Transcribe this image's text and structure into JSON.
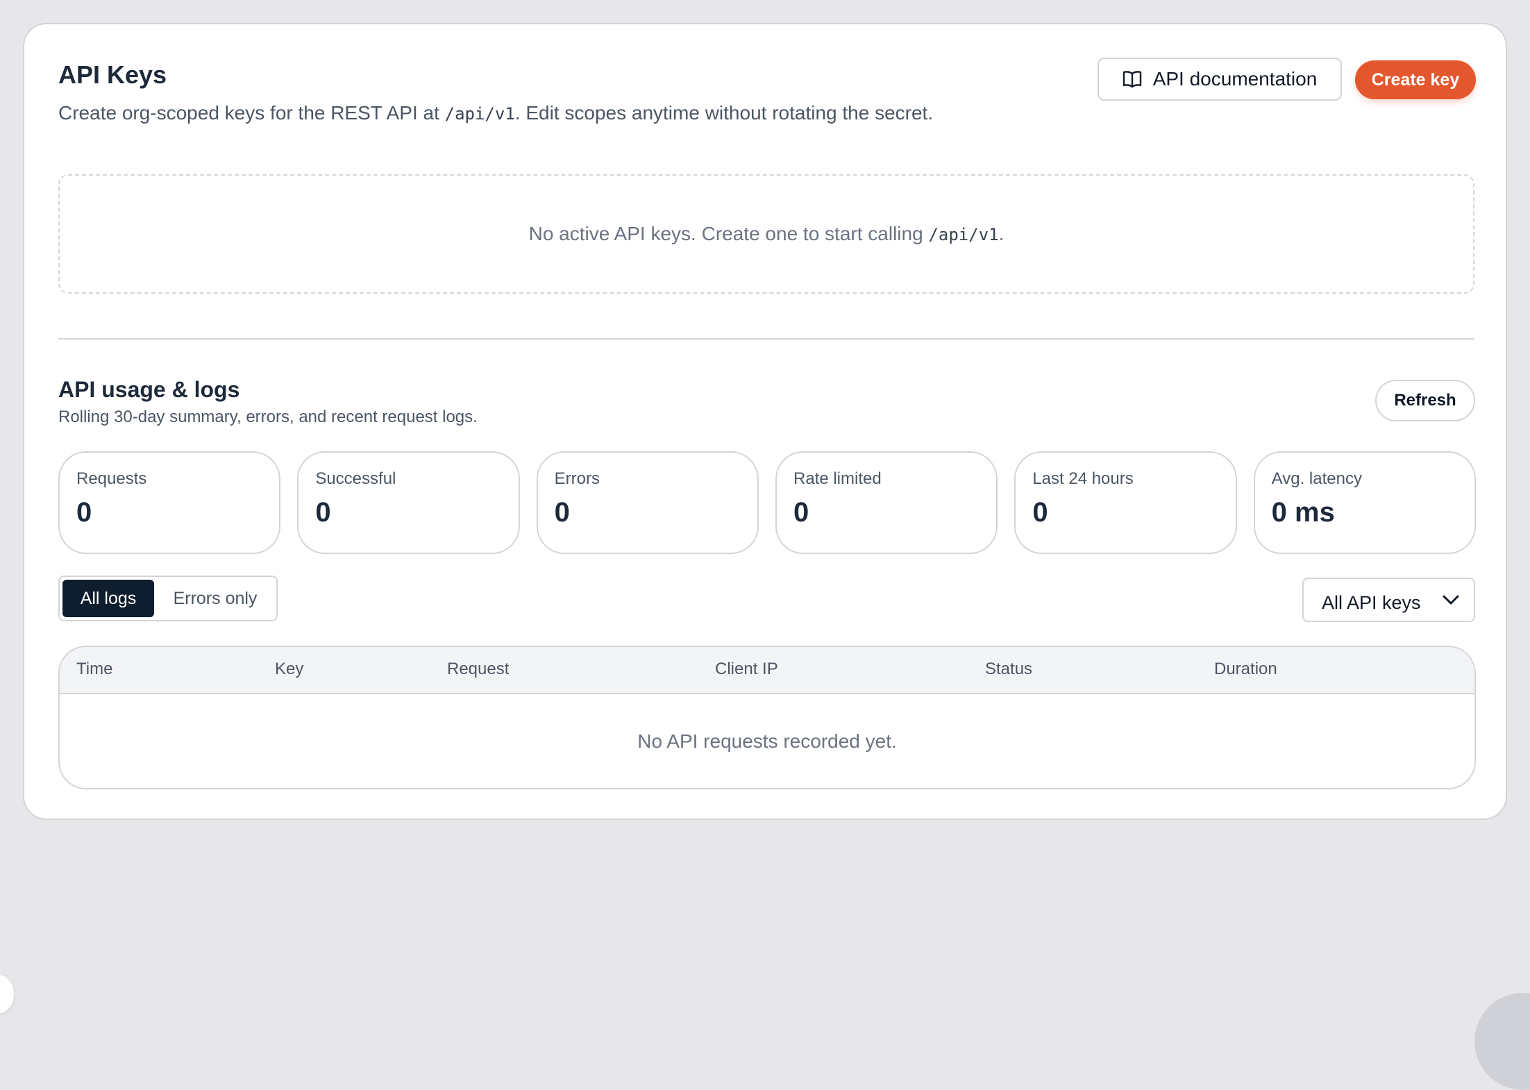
{
  "header": {
    "title": "API Keys",
    "subtitle_before": "Create org-scoped keys for the REST API at ",
    "subtitle_code": "/api/v1",
    "subtitle_after": ". Edit scopes anytime without rotating the secret.",
    "doc_button": "API documentation",
    "doc_icon": "book-icon",
    "create_button": "Create key",
    "accent_color": "#e4572e"
  },
  "keys_empty": {
    "before": "No active API keys. Create one to start calling ",
    "code": "/api/v1",
    "after": "."
  },
  "usage": {
    "title": "API usage & logs",
    "subtitle": "Rolling 30-day summary, errors, and recent request logs.",
    "refresh_button": "Refresh",
    "stats": [
      {
        "label": "Requests",
        "value": "0"
      },
      {
        "label": "Successful",
        "value": "0"
      },
      {
        "label": "Errors",
        "value": "0"
      },
      {
        "label": "Rate limited",
        "value": "0"
      },
      {
        "label": "Last 24 hours",
        "value": "0"
      },
      {
        "label": "Avg. latency",
        "value": "0 ms"
      }
    ],
    "filter": {
      "all_logs": "All logs",
      "errors_only": "Errors only",
      "selected": "All logs"
    },
    "key_select": {
      "selected": "All API keys",
      "icon": "chevron-down-icon"
    },
    "table": {
      "columns": [
        "Time",
        "Key",
        "Request",
        "Client IP",
        "Status",
        "Duration"
      ],
      "empty": "No API requests recorded yet."
    }
  }
}
